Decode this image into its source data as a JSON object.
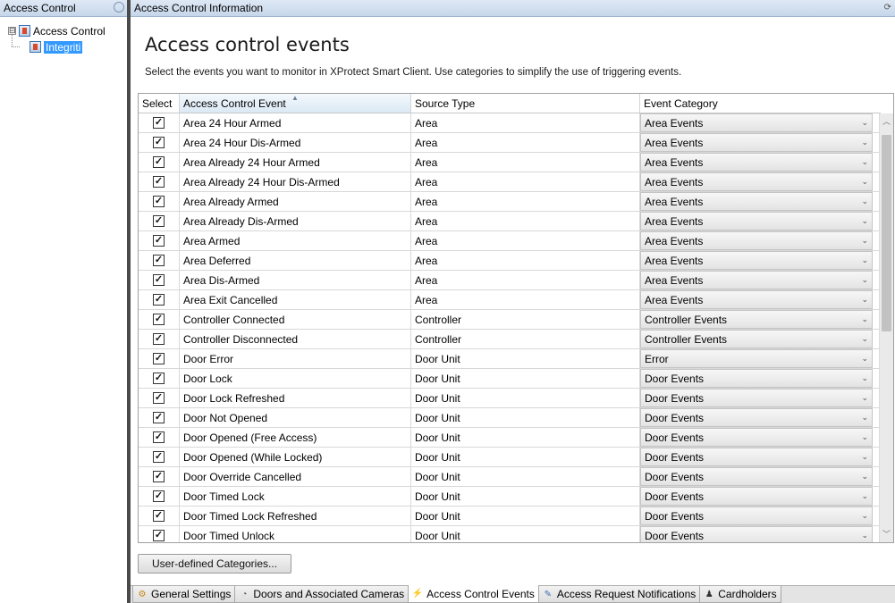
{
  "left_pane": {
    "title": "Access Control",
    "tree": {
      "root_label": "Access Control",
      "expander": "⊟",
      "child_label": "Integriti"
    }
  },
  "right_pane": {
    "title": "Access Control Information"
  },
  "page": {
    "title": "Access control events",
    "description": "Select the events you want to monitor in XProtect Smart Client. Use categories to simplify the use of triggering events."
  },
  "grid": {
    "columns": [
      "Select",
      "Access Control Event",
      "Source Type",
      "Event Category"
    ],
    "rows": [
      {
        "checked": true,
        "event": "Area 24 Hour Armed",
        "source": "Area",
        "category": "Area Events"
      },
      {
        "checked": true,
        "event": "Area 24 Hour Dis-Armed",
        "source": "Area",
        "category": "Area Events"
      },
      {
        "checked": true,
        "event": "Area Already 24 Hour Armed",
        "source": "Area",
        "category": "Area Events"
      },
      {
        "checked": true,
        "event": "Area Already 24 Hour Dis-Armed",
        "source": "Area",
        "category": "Area Events"
      },
      {
        "checked": true,
        "event": "Area Already Armed",
        "source": "Area",
        "category": "Area Events"
      },
      {
        "checked": true,
        "event": "Area Already Dis-Armed",
        "source": "Area",
        "category": "Area Events"
      },
      {
        "checked": true,
        "event": "Area Armed",
        "source": "Area",
        "category": "Area Events"
      },
      {
        "checked": true,
        "event": "Area Deferred",
        "source": "Area",
        "category": "Area Events"
      },
      {
        "checked": true,
        "event": "Area Dis-Armed",
        "source": "Area",
        "category": "Area Events"
      },
      {
        "checked": true,
        "event": "Area Exit Cancelled",
        "source": "Area",
        "category": "Area Events"
      },
      {
        "checked": true,
        "event": "Controller Connected",
        "source": "Controller",
        "category": "Controller Events"
      },
      {
        "checked": true,
        "event": "Controller Disconnected",
        "source": "Controller",
        "category": "Controller Events"
      },
      {
        "checked": true,
        "event": "Door Error",
        "source": "Door Unit",
        "category": "Error"
      },
      {
        "checked": true,
        "event": "Door Lock",
        "source": "Door Unit",
        "category": "Door Events"
      },
      {
        "checked": true,
        "event": "Door Lock Refreshed",
        "source": "Door Unit",
        "category": "Door Events"
      },
      {
        "checked": true,
        "event": "Door Not Opened",
        "source": "Door Unit",
        "category": "Door Events"
      },
      {
        "checked": true,
        "event": "Door Opened (Free Access)",
        "source": "Door Unit",
        "category": "Door Events"
      },
      {
        "checked": true,
        "event": "Door Opened (While Locked)",
        "source": "Door Unit",
        "category": "Door Events"
      },
      {
        "checked": true,
        "event": "Door Override Cancelled",
        "source": "Door Unit",
        "category": "Door Events"
      },
      {
        "checked": true,
        "event": "Door Timed Lock",
        "source": "Door Unit",
        "category": "Door Events"
      },
      {
        "checked": true,
        "event": "Door Timed Lock Refreshed",
        "source": "Door Unit",
        "category": "Door Events"
      },
      {
        "checked": true,
        "event": "Door Timed Unlock",
        "source": "Door Unit",
        "category": "Door Events"
      }
    ]
  },
  "buttons": {
    "user_defined_categories": "User-defined Categories..."
  },
  "tabs": [
    {
      "label": "General Settings",
      "icon": "gear-icon",
      "active": false
    },
    {
      "label": "Doors and Associated Cameras",
      "icon": "camera-icon",
      "active": false
    },
    {
      "label": "Access Control Events",
      "icon": "events-icon",
      "active": true
    },
    {
      "label": "Access Request Notifications",
      "icon": "notification-icon",
      "active": false
    },
    {
      "label": "Cardholders",
      "icon": "person-icon",
      "active": false
    }
  ],
  "symbols": {
    "check": "✓",
    "dropdown_arrow": "⌄",
    "scroll_up": "︿",
    "scroll_down": "﹀",
    "sort_asc": "▲"
  }
}
